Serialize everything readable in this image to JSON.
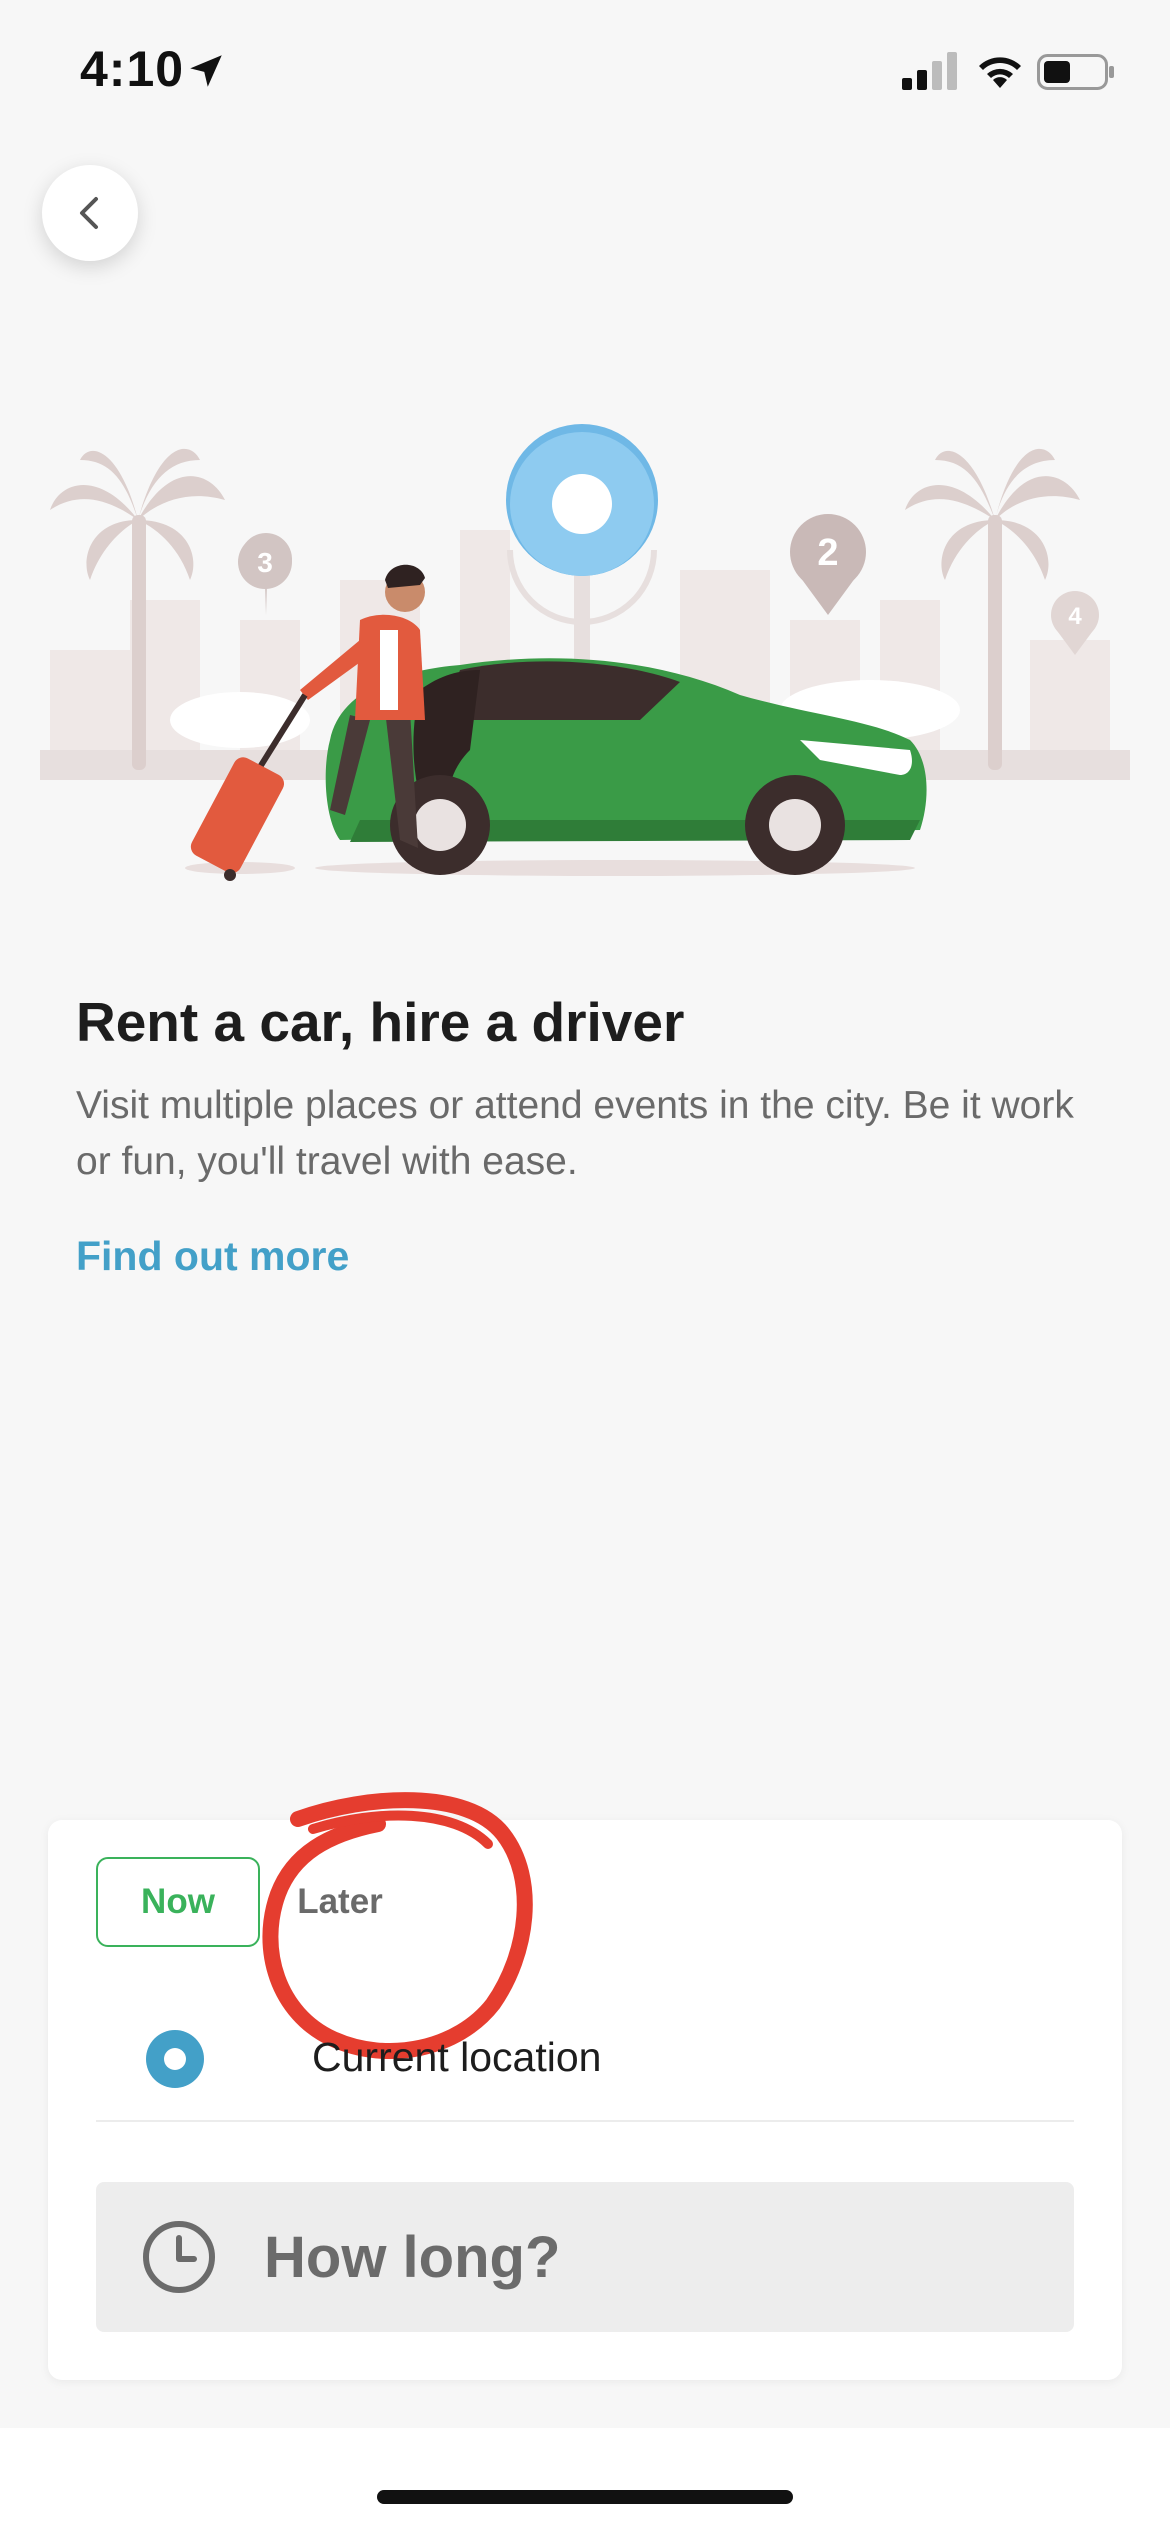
{
  "status_bar": {
    "time": "4:10",
    "icons": [
      "location-arrow-icon",
      "signal-icon",
      "wifi-icon",
      "battery-icon"
    ]
  },
  "navigation": {
    "back_icon": "chevron-left-icon"
  },
  "illustration": {
    "pin_labels": [
      "3",
      "2",
      "4"
    ],
    "colors": {
      "car": "#3a9b47",
      "luggage": "#e25a3e",
      "pin_main": "#8ecbf0",
      "background_scene": "#e7e0df"
    }
  },
  "info": {
    "title": "Rent a car, hire a driver",
    "description": "Visit multiple places or attend events in the city. Be it work or fun, you'll travel with ease.",
    "link_label": "Find out more"
  },
  "booking": {
    "tabs": [
      {
        "label": "Now",
        "selected": true
      },
      {
        "label": "Later",
        "selected": false
      }
    ],
    "pickup_label": "Current location",
    "duration_placeholder": "How long?",
    "colors": {
      "accent_green": "#3ab25b",
      "link_blue": "#43a0c8",
      "annotation_red": "#e53d2f"
    }
  }
}
